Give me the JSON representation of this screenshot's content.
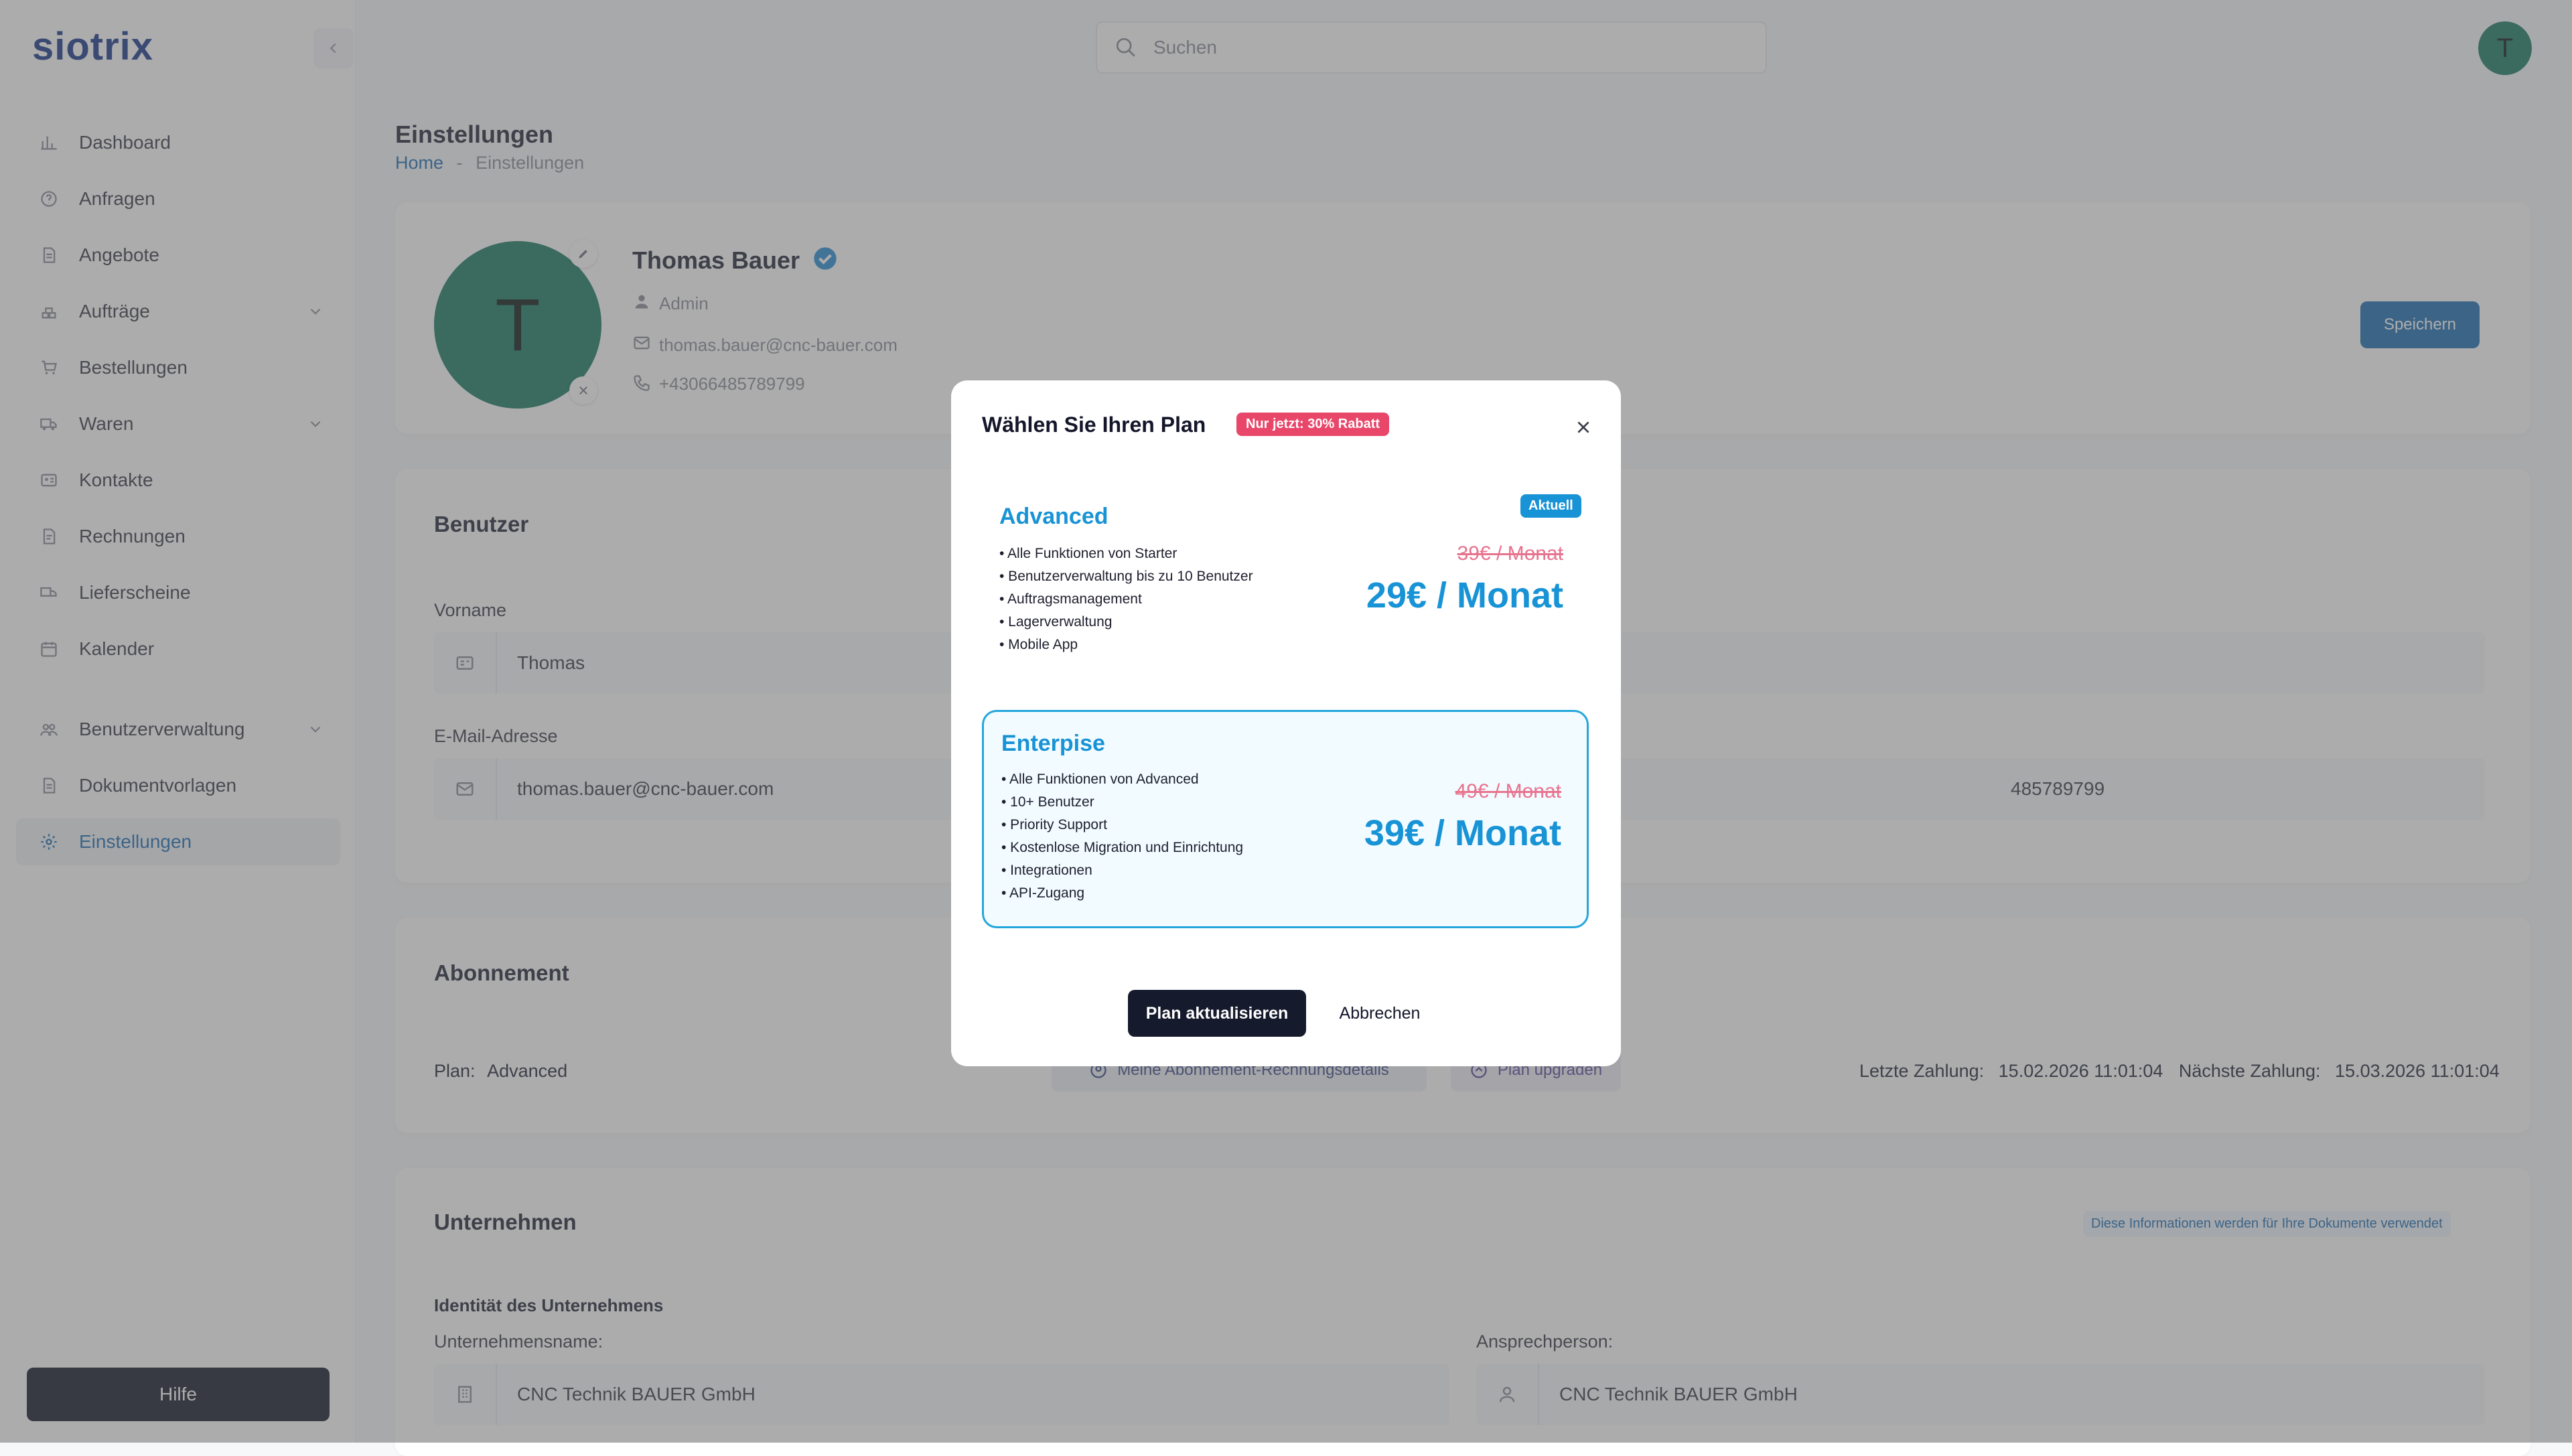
{
  "app": {
    "logo": "siotrix",
    "user_initial": "T"
  },
  "search": {
    "placeholder": "Suchen"
  },
  "sidebar": {
    "items": [
      {
        "label": "Dashboard"
      },
      {
        "label": "Anfragen"
      },
      {
        "label": "Angebote"
      },
      {
        "label": "Aufträge"
      },
      {
        "label": "Bestellungen"
      },
      {
        "label": "Waren"
      },
      {
        "label": "Kontakte"
      },
      {
        "label": "Rechnungen"
      },
      {
        "label": "Lieferscheine"
      },
      {
        "label": "Kalender"
      },
      {
        "label": "Benutzerverwaltung"
      },
      {
        "label": "Dokumentvorlagen"
      },
      {
        "label": "Einstellungen"
      }
    ],
    "help_label": "Hilfe"
  },
  "page": {
    "title": "Einstellungen",
    "breadcrumb_home": "Home",
    "breadcrumb_sep": "-",
    "breadcrumb_current": "Einstellungen"
  },
  "profile": {
    "avatar_initial": "T",
    "name": "Thomas Bauer",
    "role": "Admin",
    "email": "thomas.bauer@cnc-bauer.com",
    "phone": "+43066485789799",
    "save_label": "Speichern"
  },
  "user_section": {
    "title": "Benutzer",
    "first_name_label": "Vorname",
    "first_name_value": "Thomas",
    "email_label": "E-Mail-Adresse",
    "email_value": "thomas.bauer@cnc-bauer.com",
    "phone_value_partial": "485789799"
  },
  "subscription": {
    "title": "Abonnement",
    "plan_label": "Plan:",
    "plan_value": "Advanced",
    "billing_link": "Meine Abonnement-Rechnungsdetails",
    "upgrade_link": "Plan upgraden",
    "last_payment_label": "Letzte Zahlung:",
    "last_payment_value": "15.02.2026 11:01:04",
    "next_payment_label": "Nächste Zahlung:",
    "next_payment_value": "15.03.2026 11:01:04"
  },
  "company": {
    "title": "Unternehmen",
    "info_note": "Diese Informationen werden für Ihre Dokumente verwendet",
    "identity_title": "Identität des Unternehmens",
    "company_name_label": "Unternehmensname:",
    "company_name_value": "CNC Technik BAUER GmbH",
    "contact_label": "Ansprechperson:",
    "contact_value": "CNC Technik BAUER GmbH"
  },
  "modal": {
    "title": "Wählen Sie Ihren Plan",
    "discount_badge": "Nur jetzt: 30% Rabatt",
    "plans": [
      {
        "name": "Advanced",
        "current_badge": "Aktuell",
        "features": [
          "• Alle Funktionen von Starter",
          "• Benutzerverwaltung bis zu 10 Benutzer",
          "• Auftragsmanagement",
          "• Lagerverwaltung",
          "• Mobile App"
        ],
        "old_price": "39€ / Monat",
        "new_price": "29€ / Monat"
      },
      {
        "name": "Enterpise",
        "features": [
          "• Alle Funktionen von Advanced",
          "• 10+ Benutzer",
          "• Priority Support",
          "• Kostenlose Migration und Einrichtung",
          "• Integrationen",
          "• API-Zugang"
        ],
        "old_price": "49€ / Monat",
        "new_price": "39€ / Monat"
      }
    ],
    "update_label": "Plan aktualisieren",
    "cancel_label": "Abbrechen"
  },
  "colors": {
    "brand": "#1b3a8c",
    "accent": "#1893d6",
    "discount": "#e8476a",
    "avatar": "#1c7b65"
  }
}
